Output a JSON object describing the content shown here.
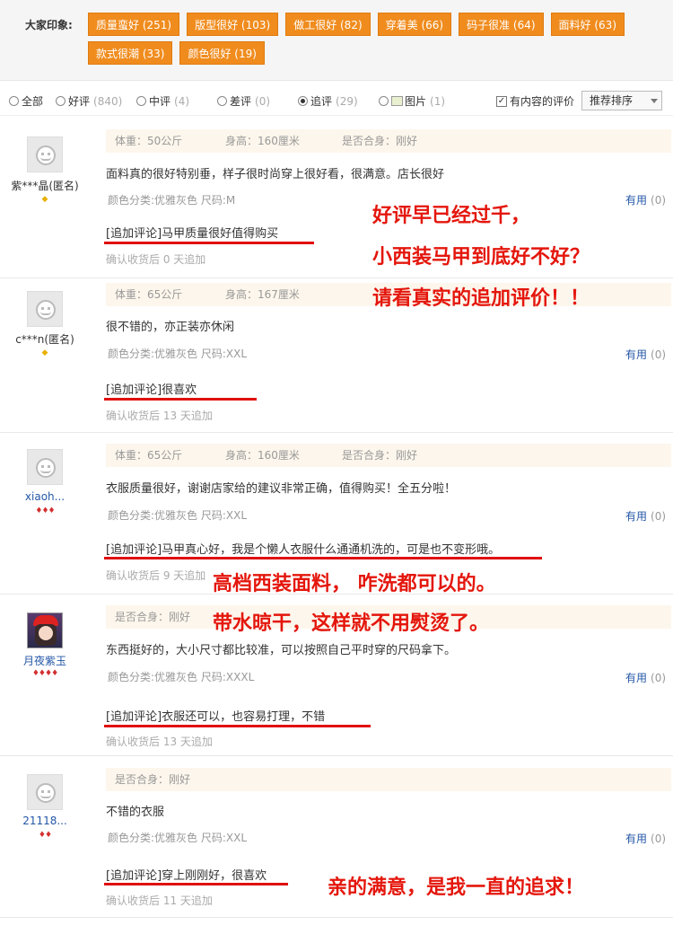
{
  "impressions": {
    "label": "大家印象:",
    "tags": [
      "质量蛮好 (251)",
      "版型很好 (103)",
      "做工很好 (82)",
      "穿着美 (66)",
      "码子很准 (64)",
      "面料好 (63)",
      "款式很潮 (33)",
      "颜色很好 (19)"
    ]
  },
  "filters": {
    "all": "全部",
    "good": "好评",
    "good_count": "(840)",
    "mid": "中评",
    "mid_count": "(4)",
    "bad": "差评",
    "bad_count": "(0)",
    "append": "追评",
    "append_count": "(29)",
    "pics": "图片",
    "pics_count": "(1)",
    "with_content": "有内容的评价",
    "sort": "推荐排序"
  },
  "useful_label": "有用",
  "reviews": [
    {
      "user": "紫***晶(匿名)",
      "weight": "体重：50公斤",
      "height": "身高：160厘米",
      "fit": "是否合身：刚好",
      "text": "面料真的很好特别垂，样子很时尚穿上很好看，很满意。店长很好",
      "sku": "颜色分类:优雅灰色  尺码:M",
      "useful": "(0)",
      "append": "[追加评论]马甲质量很好值得购买",
      "append_time": "确认收货后 0 天追加"
    },
    {
      "user": "c***n(匿名)",
      "weight": "体重：65公斤",
      "height": "身高：167厘米",
      "fit": "",
      "text": "很不错的，亦正装亦休闲",
      "sku": "颜色分类:优雅灰色  尺码:XXL",
      "useful": "(0)",
      "append": "[追加评论]很喜欢",
      "append_time": "确认收货后 13 天追加"
    },
    {
      "user": "xiaoh...",
      "weight": "体重：65公斤",
      "height": "身高：160厘米",
      "fit": "是否合身：刚好",
      "text": "衣服质量很好，谢谢店家给的建议非常正确，值得购买！全五分啦！",
      "sku": "颜色分类:优雅灰色  尺码:XXL",
      "useful": "(0)",
      "append": "[追加评论]马甲真心好，我是个懒人衣服什么通通机洗的，可是也不变形哦。",
      "append_time": "确认收货后 9 天追加"
    },
    {
      "user": "月夜紫玉",
      "weight": "",
      "height": "",
      "fit": "是否合身：刚好",
      "text": "东西挺好的，大小尺寸都比较准，可以按照自己平时穿的尺码拿下。",
      "sku": "颜色分类:优雅灰色  尺码:XXXL",
      "useful": "(0)",
      "append": "[追加评论]衣服还可以，也容易打理，不错",
      "append_time": "确认收货后 13 天追加"
    },
    {
      "user": "21118...",
      "weight": "",
      "height": "",
      "fit": "是否合身：刚好",
      "text": "不错的衣服",
      "sku": "颜色分类:优雅灰色  尺码:XXL",
      "useful": "(0)",
      "append": "[追加评论]穿上刚刚好，很喜欢",
      "append_time": "确认收货后 11 天追加"
    }
  ],
  "promo": {
    "line1": "好评早已经过千，",
    "line2": "小西装马甲到底好不好？",
    "line3": "请看真实的追加评价！！",
    "line4": "高档西装面料， 咋洗都可以的。",
    "line5": "带水晾干，这样就不用熨烫了。",
    "line6": "亲的满意，是我一直的追求！"
  }
}
